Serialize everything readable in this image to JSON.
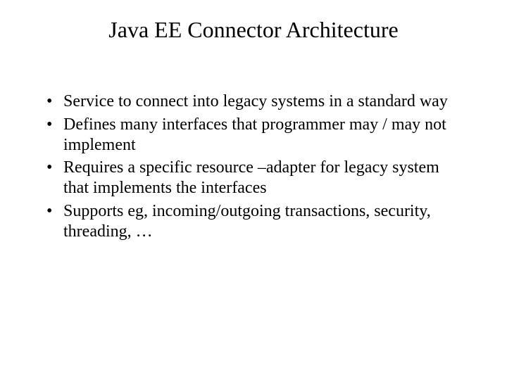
{
  "slide": {
    "title": "Java EE Connector Architecture",
    "bullets": [
      "Service to connect into legacy systems in a standard way",
      "Defines many interfaces that programmer may / may not implement",
      "Requires a specific resource –adapter for legacy system that implements the interfaces",
      "Supports eg, incoming/outgoing transactions, security, threading, …"
    ]
  }
}
